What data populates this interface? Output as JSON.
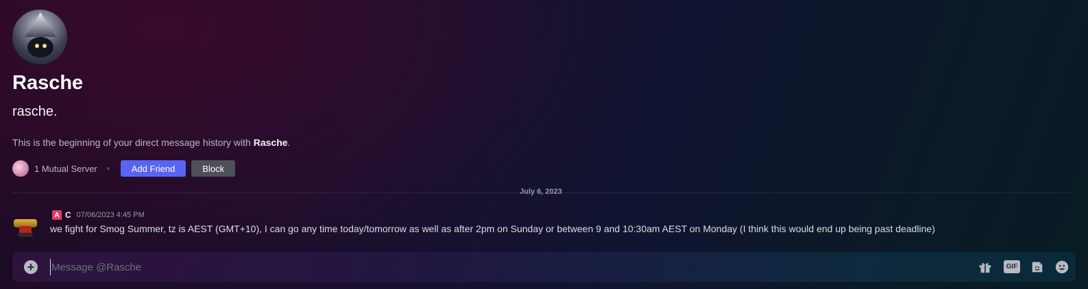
{
  "profile": {
    "display_name": "Rasche",
    "username": "rasche.",
    "intro_prefix": "This is the beginning of your direct message history with ",
    "intro_name": "Rasche",
    "intro_suffix": ".",
    "mutual_servers": "1 Mutual Server",
    "add_friend_label": "Add Friend",
    "block_label": "Block"
  },
  "divider": {
    "date": "July 6, 2023"
  },
  "messages": [
    {
      "role_badge": "A",
      "author": "C",
      "timestamp": "07/06/2023 4:45 PM",
      "text": "we fight for Smog Summer, tz is AEST (GMT+10), I can go any time today/tomorrow as well as after 2pm on Sunday or between 9 and 10:30am AEST on Monday (I think this would end up being past deadline)"
    }
  ],
  "composer": {
    "placeholder": "Message @Rasche",
    "gif_label": "GIF",
    "icons": [
      "plus-circle-icon",
      "gift-icon",
      "gif-icon",
      "sticker-icon",
      "emoji-icon"
    ]
  },
  "colors": {
    "add_friend": "#5865f2",
    "block": "#4e5058",
    "role_badge": "#e23d61"
  }
}
